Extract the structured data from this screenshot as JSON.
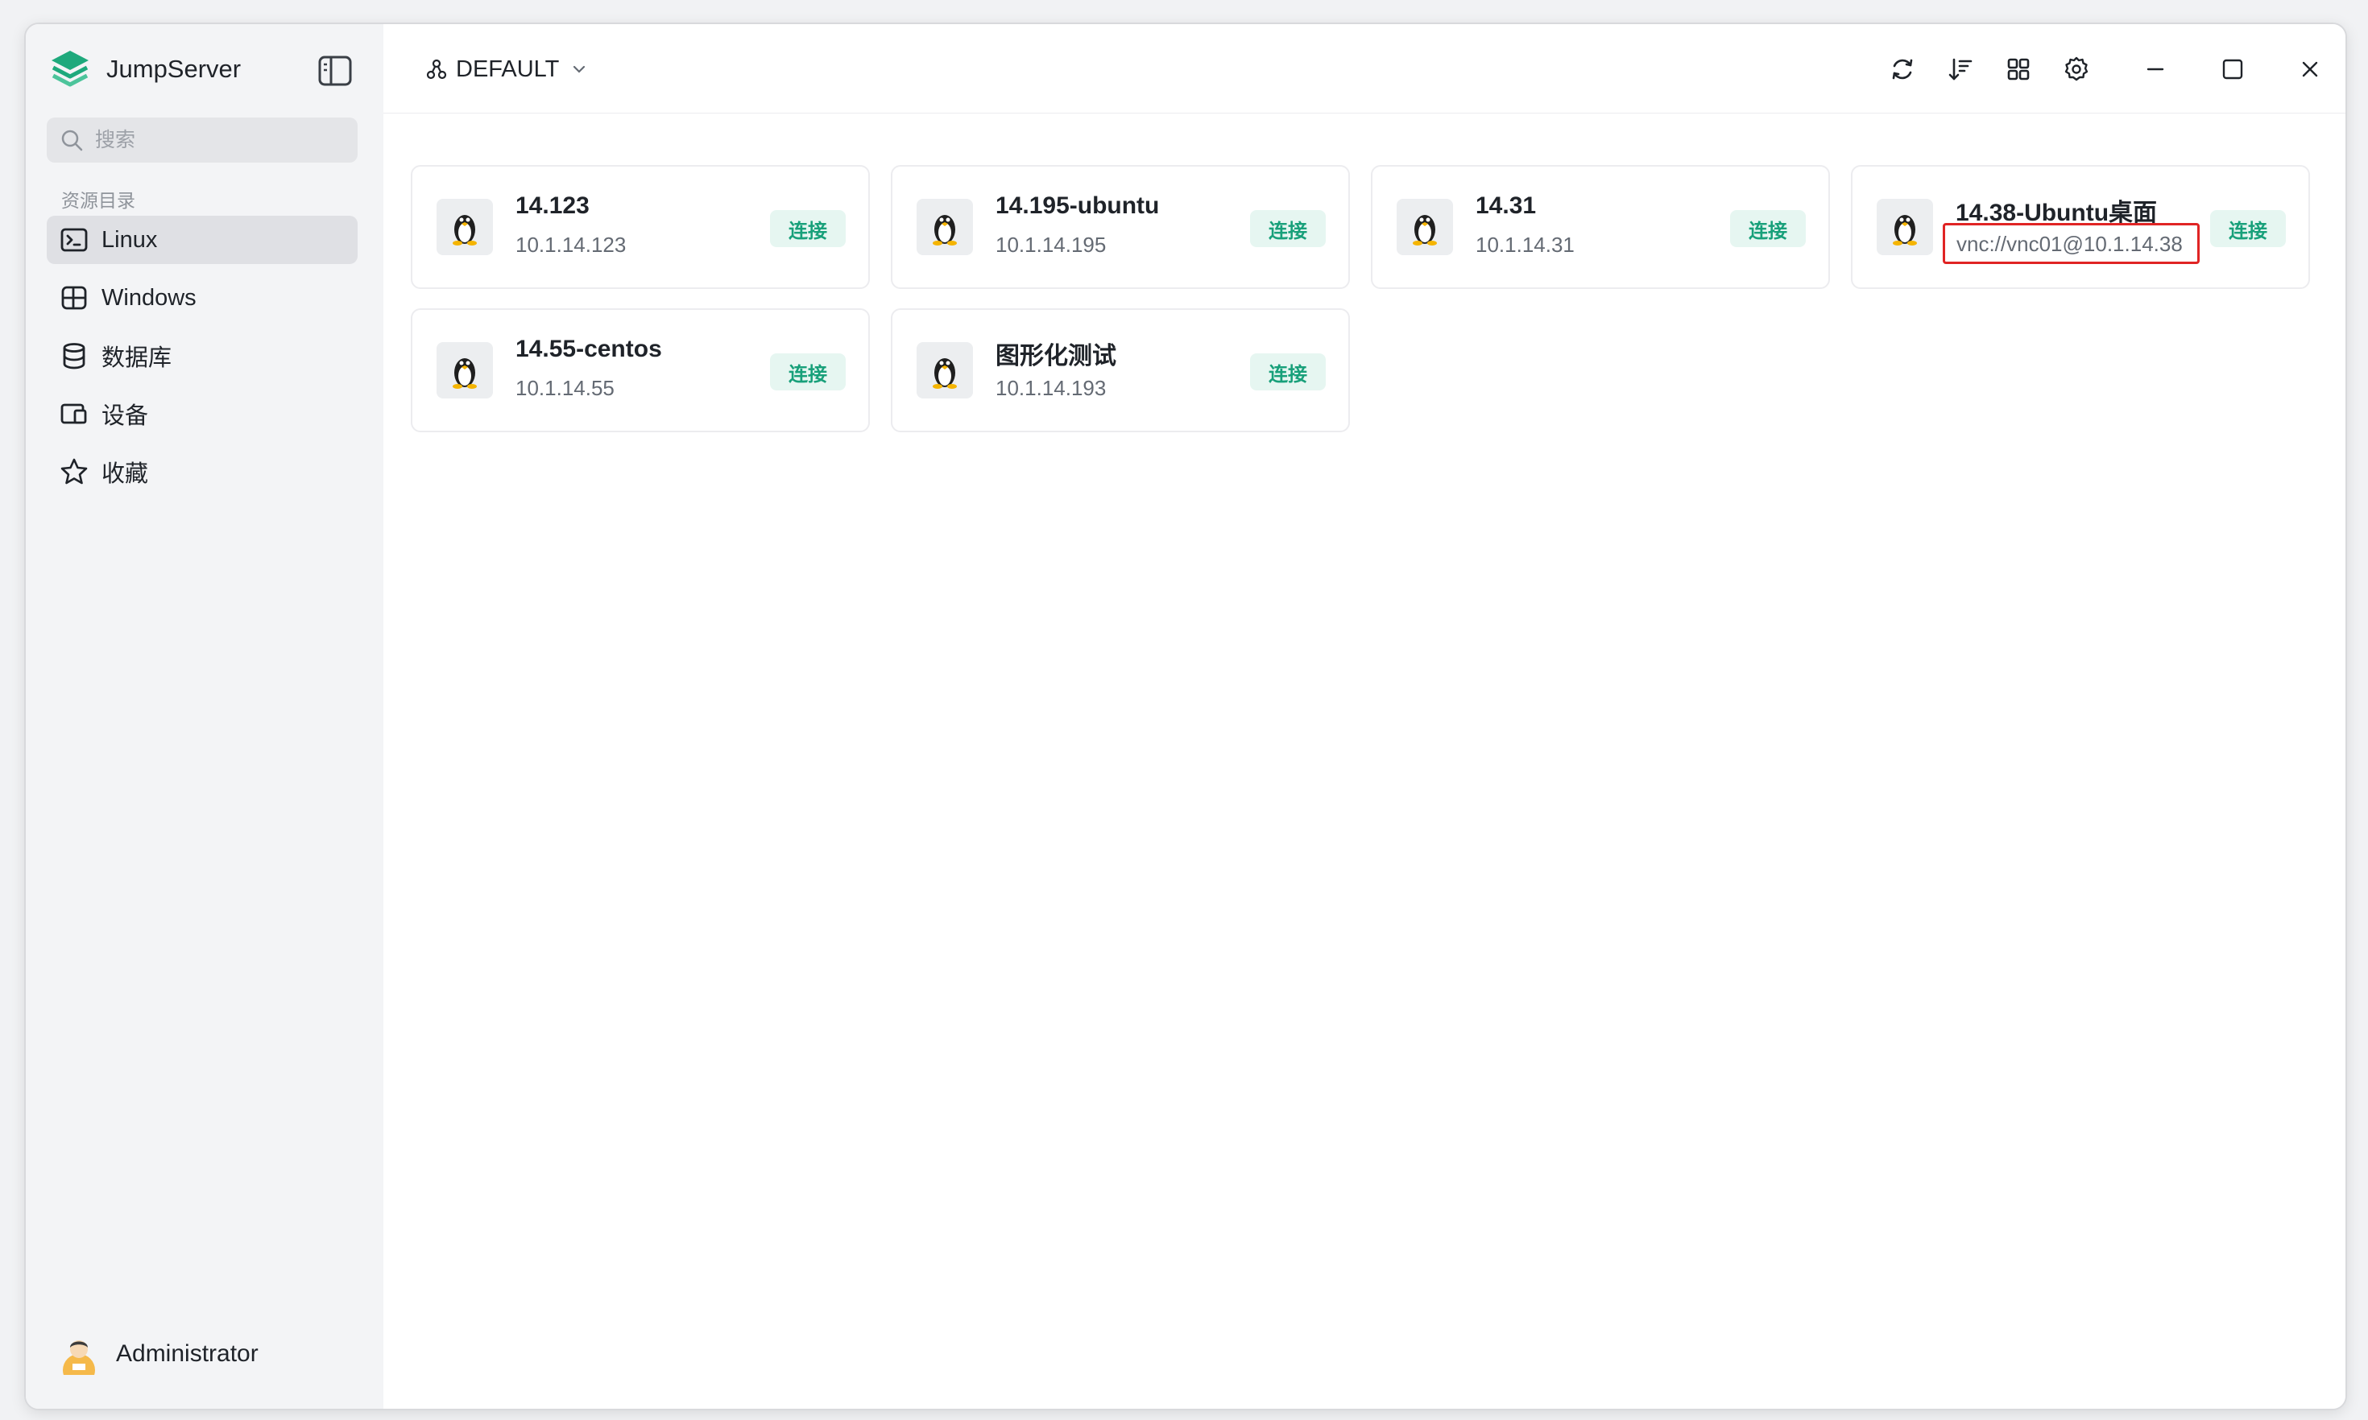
{
  "app": {
    "name": "JumpServer"
  },
  "search": {
    "placeholder": "搜索"
  },
  "sidebar": {
    "section_label": "资源目录",
    "items": [
      {
        "label": "Linux",
        "icon": "terminal-icon",
        "active": true
      },
      {
        "label": "Windows",
        "icon": "windows-icon",
        "active": false
      },
      {
        "label": "数据库",
        "icon": "database-icon",
        "active": false
      },
      {
        "label": "设备",
        "icon": "device-icon",
        "active": false
      },
      {
        "label": "收藏",
        "icon": "star-icon",
        "active": false
      }
    ],
    "user": {
      "name": "Administrator"
    }
  },
  "header": {
    "org_label": "DEFAULT",
    "toolbar": [
      "refresh-icon",
      "sort-icon",
      "grid-view-icon",
      "settings-icon",
      "minimize-icon",
      "maximize-icon",
      "close-icon"
    ]
  },
  "assets": [
    {
      "name": "14.123",
      "address": "10.1.14.123",
      "connect_label": "连接",
      "highlighted": false
    },
    {
      "name": "14.195-ubuntu",
      "address": "10.1.14.195",
      "connect_label": "连接",
      "highlighted": false
    },
    {
      "name": "14.31",
      "address": "10.1.14.31",
      "connect_label": "连接",
      "highlighted": false
    },
    {
      "name": "14.38-Ubuntu桌面",
      "address": "vnc://vnc01@10.1.14.38",
      "connect_label": "连接",
      "highlighted": true
    },
    {
      "name": "14.55-centos",
      "address": "10.1.14.55",
      "connect_label": "连接",
      "highlighted": false
    },
    {
      "name": "图形化测试",
      "address": "10.1.14.193",
      "connect_label": "连接",
      "highlighted": false
    }
  ],
  "colors": {
    "brand": "#1ea97c",
    "connect_bg": "#e6f6f1",
    "connect_text": "#18a07a",
    "highlight_border": "#e02424"
  }
}
